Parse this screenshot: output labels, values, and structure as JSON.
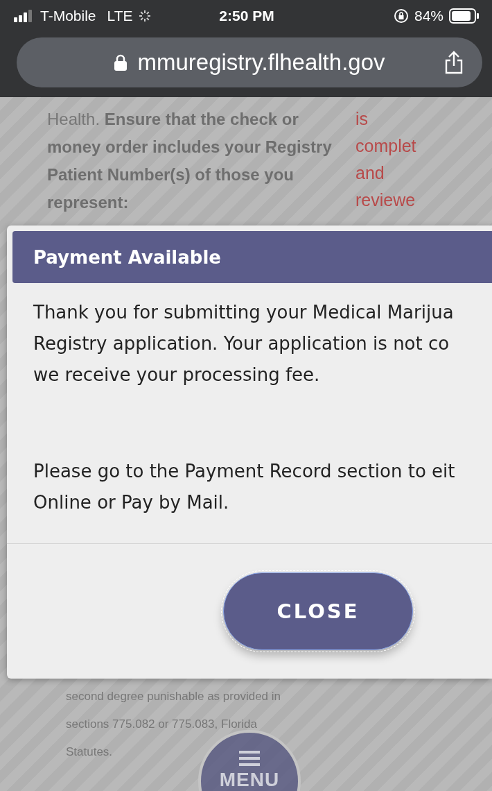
{
  "status_bar": {
    "carrier": "T-Mobile",
    "network": "LTE",
    "time": "2:50 PM",
    "battery": "84%"
  },
  "address_bar": {
    "url": "mmuregistry.flhealth.gov"
  },
  "page": {
    "paragraph": "Health. **Ensure that the check or money order includes your Registry Patient Number(s) of those you represent:**",
    "side_words": [
      "is",
      "complet",
      "and",
      "reviewe"
    ],
    "footer_lines": [
      "second degree punishable as provided in",
      "sections 775.082 or 775.083, Florida",
      "Statutes."
    ]
  },
  "modal": {
    "title": "Payment Available",
    "paragraphs": [
      [
        "Thank you for submitting your Medical Marijua",
        "Registry application. Your application is not co",
        "we receive your processing fee."
      ],
      [
        "Please go to the Payment Record section to eit",
        "Online or Pay by Mail."
      ]
    ],
    "button": {
      "label": "CLOSE",
      "focused": true
    }
  },
  "menu_button": {
    "label": "MENU"
  }
}
